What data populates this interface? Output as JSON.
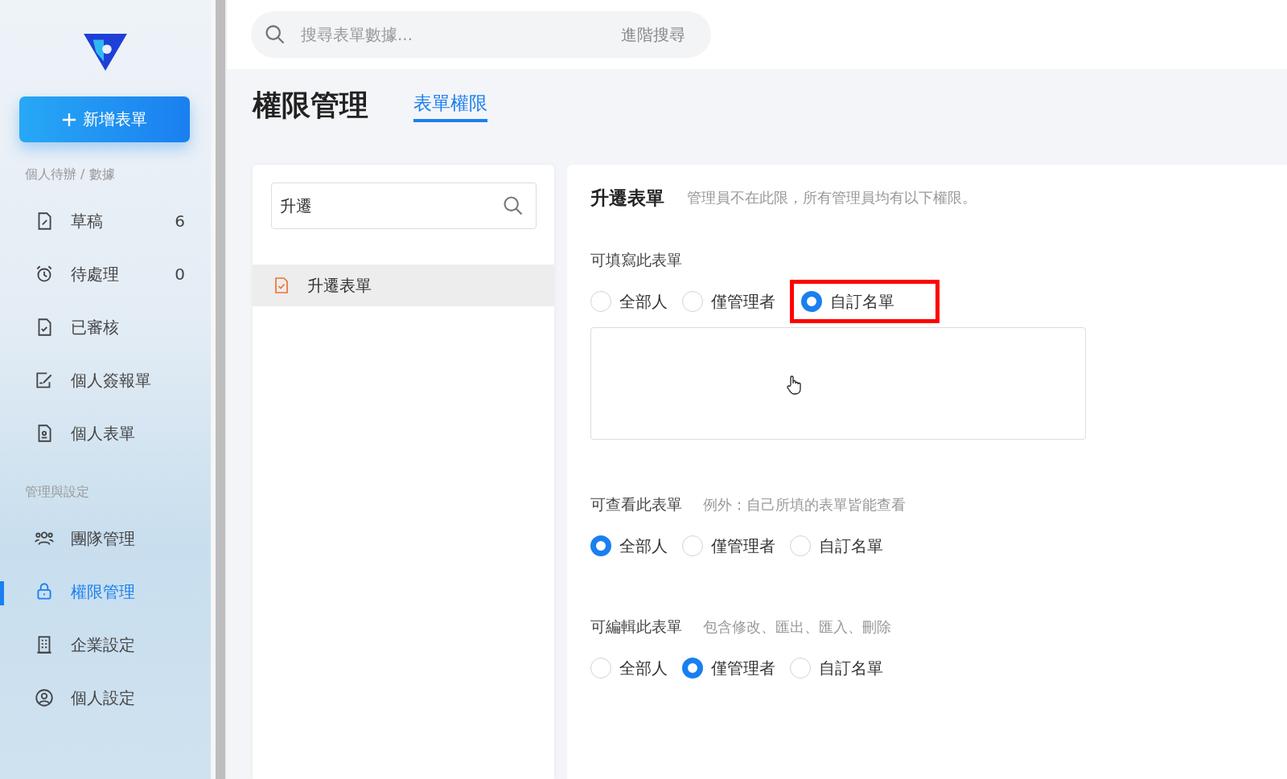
{
  "sidebar": {
    "new_button": "新增表單",
    "groups": [
      {
        "heading": "個人待辦 / 數據",
        "items": [
          {
            "label": "草稿",
            "count": "6",
            "selected": false
          },
          {
            "label": "待處理",
            "count": "0",
            "selected": false
          },
          {
            "label": "已審核",
            "selected": false
          },
          {
            "label": "個人簽報單",
            "selected": false
          },
          {
            "label": "個人表單",
            "selected": false
          }
        ]
      },
      {
        "heading": "管理與設定",
        "items": [
          {
            "label": "團隊管理",
            "selected": false
          },
          {
            "label": "權限管理",
            "selected": true
          },
          {
            "label": "企業設定",
            "selected": false
          },
          {
            "label": "個人設定",
            "selected": false
          }
        ]
      }
    ]
  },
  "search": {
    "placeholder": "搜尋表單數據...",
    "advanced": "進階搜尋"
  },
  "page": {
    "title": "權限管理",
    "tabs": [
      {
        "label": "表單權限",
        "selected": true
      }
    ]
  },
  "form_list": {
    "search_value": "升遷",
    "items": [
      {
        "label": "升遷表單",
        "selected": true
      }
    ]
  },
  "detail": {
    "title": "升遷表單",
    "note": "管理員不在此限，所有管理員均有以下權限。",
    "sections": [
      {
        "label": "可填寫此表單",
        "options": [
          {
            "label": "全部人",
            "selected": false,
            "highlighted": false
          },
          {
            "label": "僅管理者",
            "selected": false,
            "highlighted": false
          },
          {
            "label": "自訂名單",
            "selected": true,
            "highlighted": true
          }
        ],
        "list_box": true
      },
      {
        "label": "可查看此表單",
        "note": "例外：自己所填的表單皆能查看",
        "options": [
          {
            "label": "全部人",
            "selected": true,
            "highlighted": false
          },
          {
            "label": "僅管理者",
            "selected": false,
            "highlighted": false
          },
          {
            "label": "自訂名單",
            "selected": false,
            "highlighted": false
          }
        ]
      },
      {
        "label": "可編輯此表單",
        "note": "包含修改、匯出、匯入、刪除",
        "options": [
          {
            "label": "全部人",
            "selected": false,
            "highlighted": false
          },
          {
            "label": "僅管理者",
            "selected": true,
            "highlighted": false
          },
          {
            "label": "自訂名單",
            "selected": false,
            "highlighted": false
          }
        ]
      }
    ]
  }
}
